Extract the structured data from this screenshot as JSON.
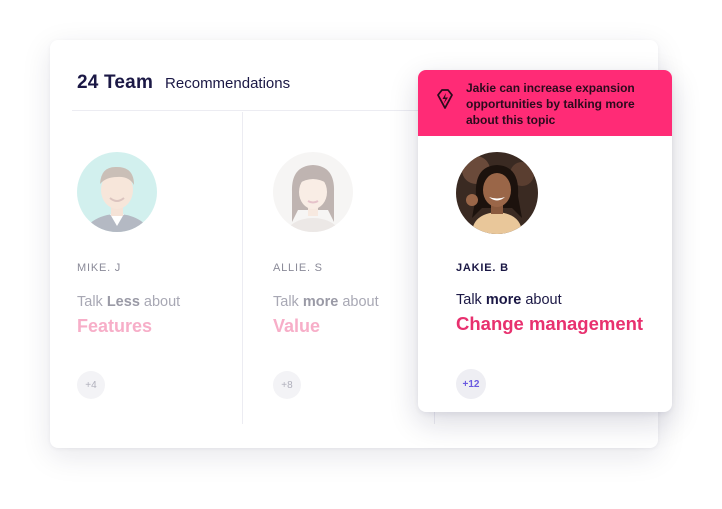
{
  "header": {
    "team_count": "24 Team",
    "recommendations_label": "Recommendations"
  },
  "members": [
    {
      "name": "MIKE. J",
      "talk_prefix": "Talk",
      "talk_emphasis": "Less",
      "talk_suffix": "about",
      "topic": "Features",
      "count": "+4"
    },
    {
      "name": "ALLIE. S",
      "talk_prefix": "Talk",
      "talk_emphasis": "more",
      "talk_suffix": "about",
      "topic": "Value",
      "count": "+8"
    }
  ],
  "highlight": {
    "banner_text": "Jakie can increase expansion opportunities by talking more about this topic",
    "banner_icon": "diamond-lightning-icon",
    "name": "JAKIE. B",
    "talk_prefix": "Talk",
    "talk_emphasis": "more",
    "talk_suffix": "about",
    "topic": "Change management",
    "count": "+12"
  },
  "colors": {
    "accent_pink": "#ff2b76",
    "topic_pink": "#e8316f",
    "navy": "#1b1845",
    "badge_purple": "#6a5ae0"
  }
}
